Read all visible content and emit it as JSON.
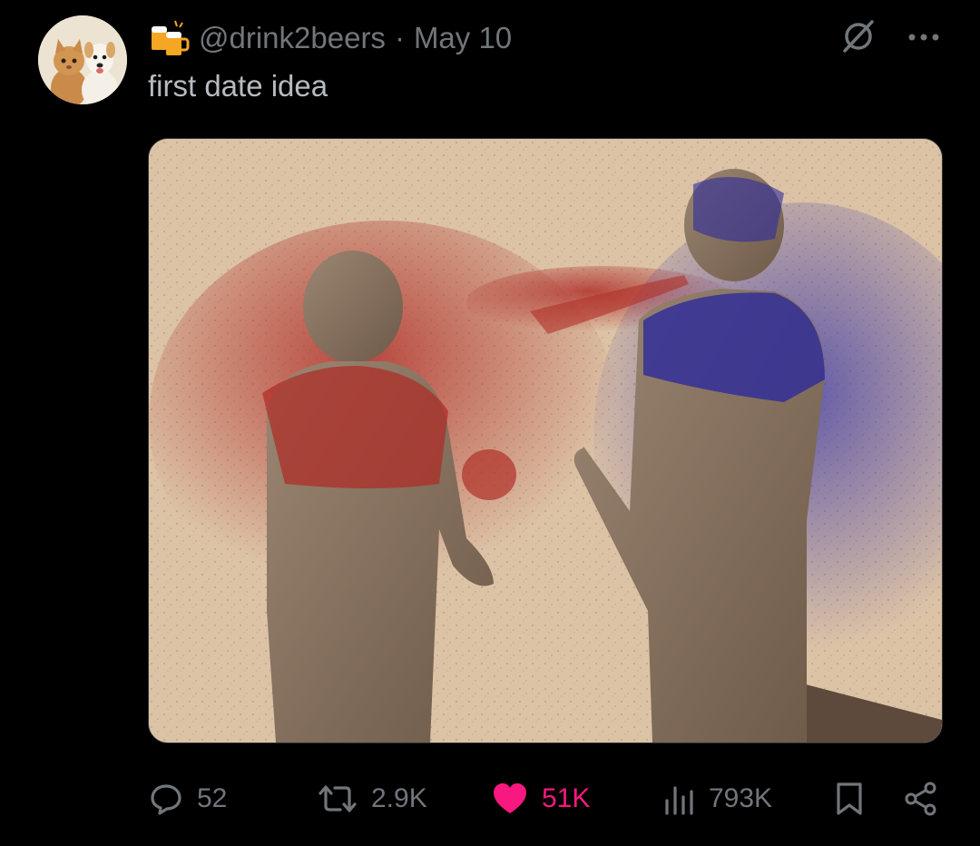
{
  "tweet": {
    "handle": "@drink2beers",
    "separator": "·",
    "date": "May 10",
    "text": "first date idea"
  },
  "icons": {
    "avatar": "cat-and-dog-avatar",
    "display_name_emoji": "beer-mugs-icon",
    "grok": "grok-icon",
    "more": "more-icon",
    "reply": "reply-icon",
    "retweet": "retweet-icon",
    "like": "heart-icon",
    "views": "analytics-icon",
    "bookmark": "bookmark-icon",
    "share": "share-icon"
  },
  "stats": {
    "replies": "52",
    "retweets": "2.9K",
    "likes": "51K",
    "views": "793K"
  },
  "colors": {
    "background": "#000000",
    "muted": "#71767b",
    "like_active": "#f91880",
    "text": "#b7bbbe"
  }
}
